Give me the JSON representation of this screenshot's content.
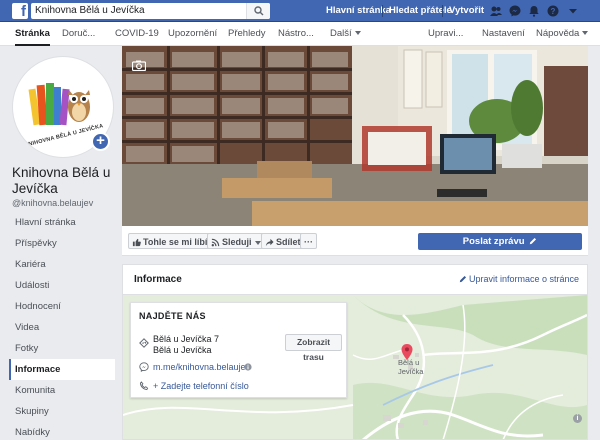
{
  "topbar": {
    "search_value": "Knihovna Bělá u Jevíčka",
    "links": [
      "Hlavní stránka",
      "Hledat přátele",
      "Vytvořit"
    ],
    "brand_color": "#4267b2"
  },
  "navbar": {
    "tabs": [
      "Stránka",
      "Doruč...",
      "COVID-19",
      "Upozornění",
      "Přehledy",
      "Nástro...",
      "Další"
    ],
    "right": [
      "Upravi...",
      "Nastavení",
      "Nápověda"
    ]
  },
  "profile": {
    "logo_text": "KNIHOVNA BĚLÁ U JEVÍČKA",
    "name": "Knihovna Bělá u Jevíčka",
    "handle": "@knihovna.belaujev"
  },
  "sidenav": {
    "items": [
      "Hlavní stránka",
      "Příspěvky",
      "Kariéra",
      "Události",
      "Hodnocení",
      "Videa",
      "Fotky",
      "Informace",
      "Komunita",
      "Skupiny",
      "Nabídky"
    ],
    "active": "Informace"
  },
  "actions": {
    "like": "Tohle se mi líbí",
    "follow": "Sleduji",
    "share": "Sdílet",
    "more": "···",
    "send_message": "Poslat zprávu"
  },
  "info": {
    "title": "Informace",
    "edit_link": "Upravit informace o stránce",
    "find_us": "NAJDĚTE NÁS",
    "address_line1": "Bělá u Jevíčka 7",
    "address_line2": "Bělá u Jevíčka",
    "route_button": "Zobrazit trasu",
    "messenger_link": "m.me/knihovna.belaujev",
    "phone_prompt": "+ Zadejte telefonní číslo",
    "map_label": "Bělá u Jevíčka"
  }
}
